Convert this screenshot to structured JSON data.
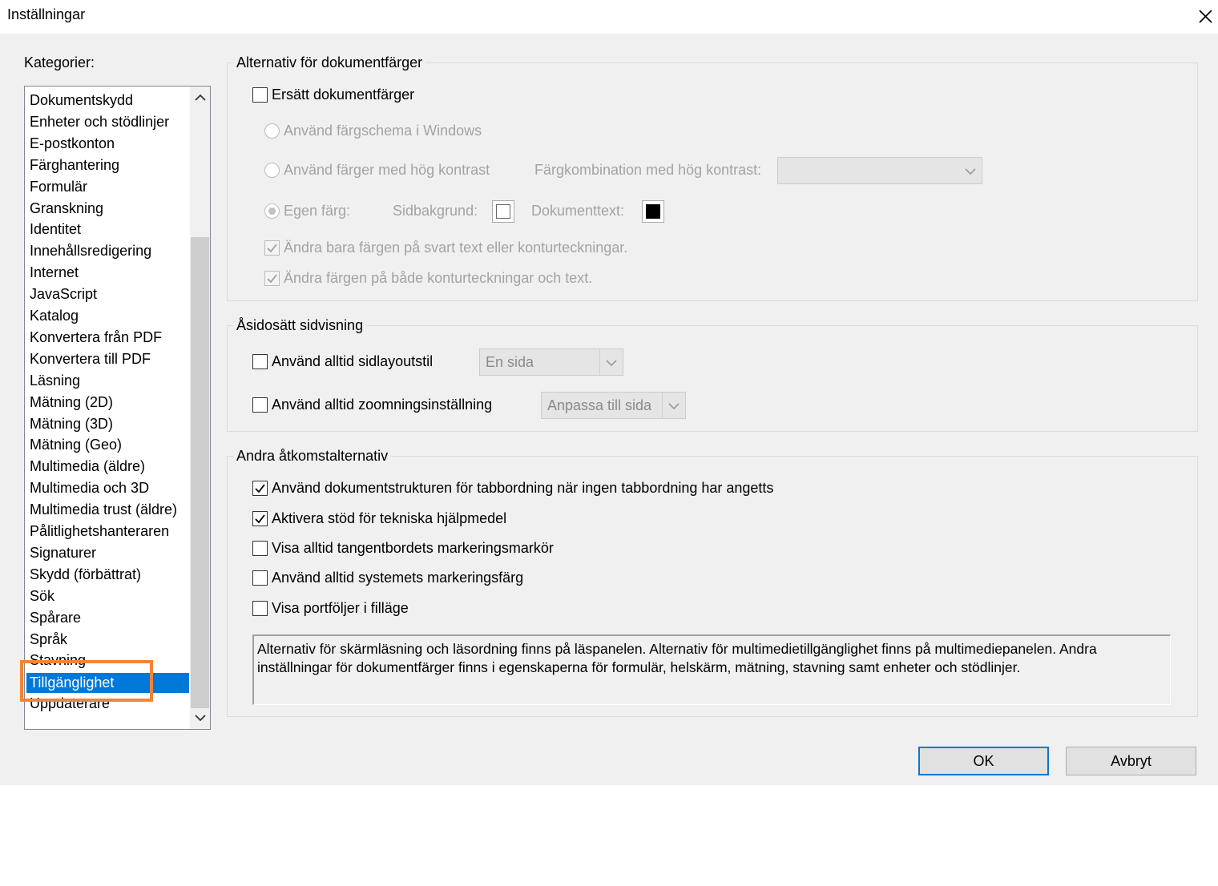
{
  "window": {
    "title": "Inställningar"
  },
  "categories": {
    "label": "Kategorier:",
    "items": [
      "Dokumentskydd",
      "Enheter och stödlinjer",
      "E-postkonton",
      "Färghantering",
      "Formulär",
      "Granskning",
      "Identitet",
      "Innehållsredigering",
      "Internet",
      "JavaScript",
      "Katalog",
      "Konvertera från PDF",
      "Konvertera till PDF",
      "Läsning",
      "Mätning (2D)",
      "Mätning (3D)",
      "Mätning (Geo)",
      "Multimedia (äldre)",
      "Multimedia och 3D",
      "Multimedia trust (äldre)",
      "Pålitlighetshanteraren",
      "Signaturer",
      "Skydd (förbättrat)",
      "Sök",
      "Spårare",
      "Språk",
      "Stavning",
      "Tillgänglighet",
      "Uppdaterare"
    ],
    "selected": "Tillgänglighet"
  },
  "doc_colors": {
    "title": "Alternativ för dokumentfärger",
    "replace_label": "Ersätt dokumentfärger",
    "replace_checked": false,
    "windows_scheme_label": "Använd färgschema i Windows",
    "high_contrast_label": "Använd färger med hög kontrast",
    "high_contrast_combo_label": "Färgkombination med hög kontrast:",
    "high_contrast_combo_value": "",
    "custom_label": "Egen färg:",
    "page_bg_label": "Sidbakgrund:",
    "page_bg_color": "#ffffff",
    "doc_text_label": "Dokumenttext:",
    "doc_text_color": "#000000",
    "only_black_label": "Ändra bara färgen på svart text eller konturteckningar.",
    "only_black_checked": true,
    "both_label": "Ändra färgen på både konturteckningar och text.",
    "both_checked": true
  },
  "override": {
    "title": "Åsidosätt sidvisning",
    "layout_label": "Använd alltid sidlayoutstil",
    "layout_checked": false,
    "layout_value": "En sida",
    "zoom_label": "Använd alltid zoomningsinställning",
    "zoom_checked": false,
    "zoom_value": "Anpassa till sida"
  },
  "other": {
    "title": "Andra åtkomstalternativ",
    "items": [
      {
        "label": "Använd dokumentstrukturen för tabbordning när ingen tabbordning har angetts",
        "checked": true
      },
      {
        "label": "Aktivera stöd för tekniska hjälpmedel",
        "checked": true
      },
      {
        "label": "Visa alltid tangentbordets markeringsmarkör",
        "checked": false
      },
      {
        "label": "Använd alltid systemets markeringsfärg",
        "checked": false
      },
      {
        "label": "Visa portföljer i filläge",
        "checked": false
      }
    ],
    "info_line1": "Alternativ för skärmläsning och läsordning finns på läspanelen. Alternativ för multimedietillgänglighet finns på multimediepanelen. Andra",
    "info_line2": "inställningar för dokumentfärger finns i egenskaperna för formulär, helskärm, mätning, stavning samt enheter och stödlinjer."
  },
  "buttons": {
    "ok": "OK",
    "cancel": "Avbryt"
  },
  "colors": {
    "selection": "#0078d7",
    "highlight_box": "#f08537"
  }
}
